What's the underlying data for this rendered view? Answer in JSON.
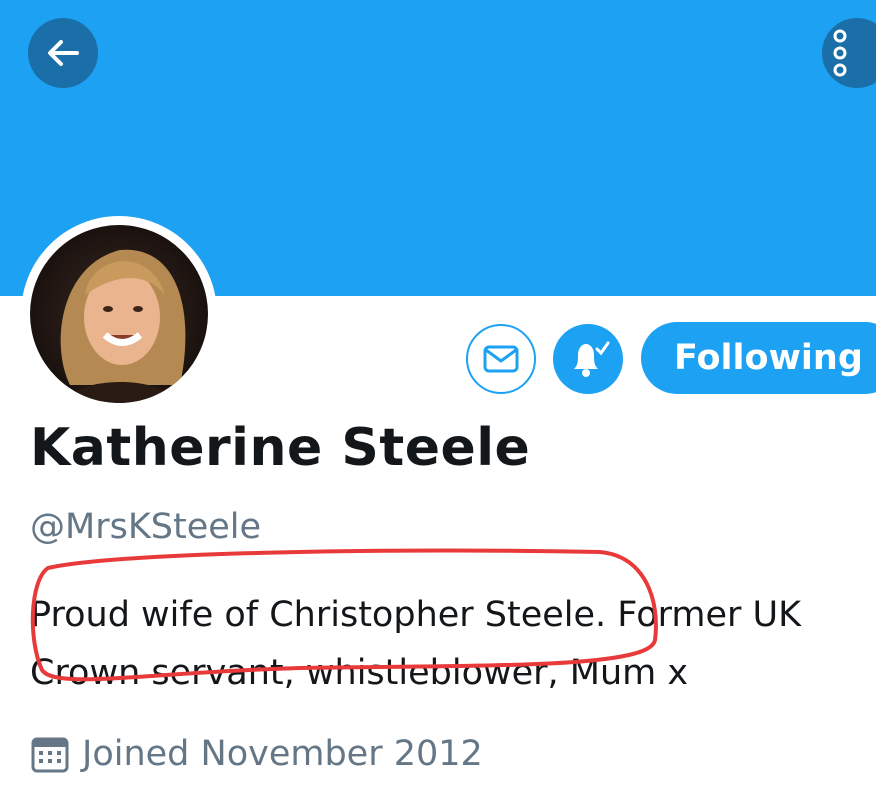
{
  "header": {
    "banner_color": "#1da1f2"
  },
  "nav": {
    "back_icon": "arrow-left-icon",
    "more_icon": "vertical-dots-icon"
  },
  "actions": {
    "message_icon": "envelope-icon",
    "notify_icon": "bell-check-icon",
    "follow_label": "Following"
  },
  "profile": {
    "name": "Katherine Steele",
    "handle": "@MrsKSteele",
    "bio_line1": "Proud wife of Christopher Steele. Former UK",
    "bio_line2": "Crown servant, whistleblower, Mum x",
    "joined": "Joined November 2012"
  },
  "colors": {
    "accent": "#1da1f2",
    "muted": "#657786",
    "annotation": "#e83a3a"
  }
}
